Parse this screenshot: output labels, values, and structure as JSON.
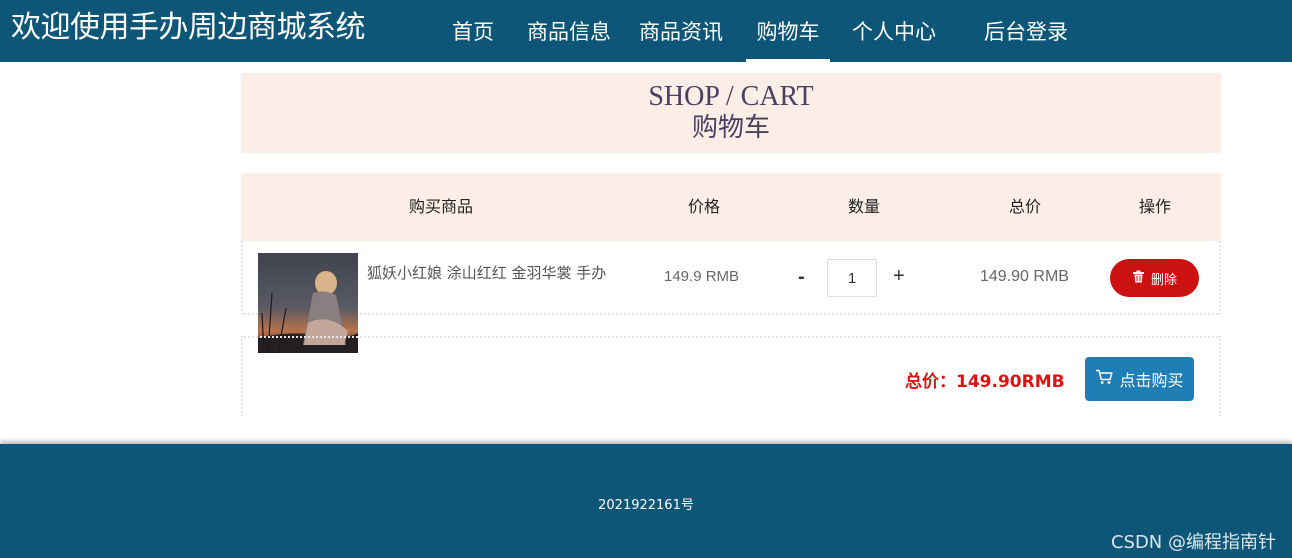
{
  "header": {
    "site_title": "欢迎使用手办周边商城系统",
    "nav": [
      "首页",
      "商品信息",
      "商品资讯",
      "购物车",
      "个人中心",
      "后台登录"
    ],
    "active_nav": "购物车"
  },
  "banner": {
    "title_en": "SHOP / CART",
    "title_zh": "购物车"
  },
  "table": {
    "headers": [
      "购买商品",
      "价格",
      "数量",
      "总价",
      "操作"
    ],
    "rows": [
      {
        "name": "狐妖小红娘 涂山红红 金羽华裳 手办",
        "price": "149.9 RMB",
        "quantity": "1",
        "line_total": "149.90 RMB",
        "minus": "-",
        "plus": "+",
        "delete_label": "删除"
      }
    ]
  },
  "summary": {
    "total_label": "总价：149.90RMB",
    "buy_label": "点击购买"
  },
  "footer": {
    "text": "2021922161号",
    "watermark": "CSDN @编程指南针"
  },
  "colors": {
    "nav_bg": "#0d5678",
    "banner_bg": "#fbeee6",
    "delete": "#cc1111",
    "buy": "#1f7fb5",
    "total": "#e01111"
  }
}
